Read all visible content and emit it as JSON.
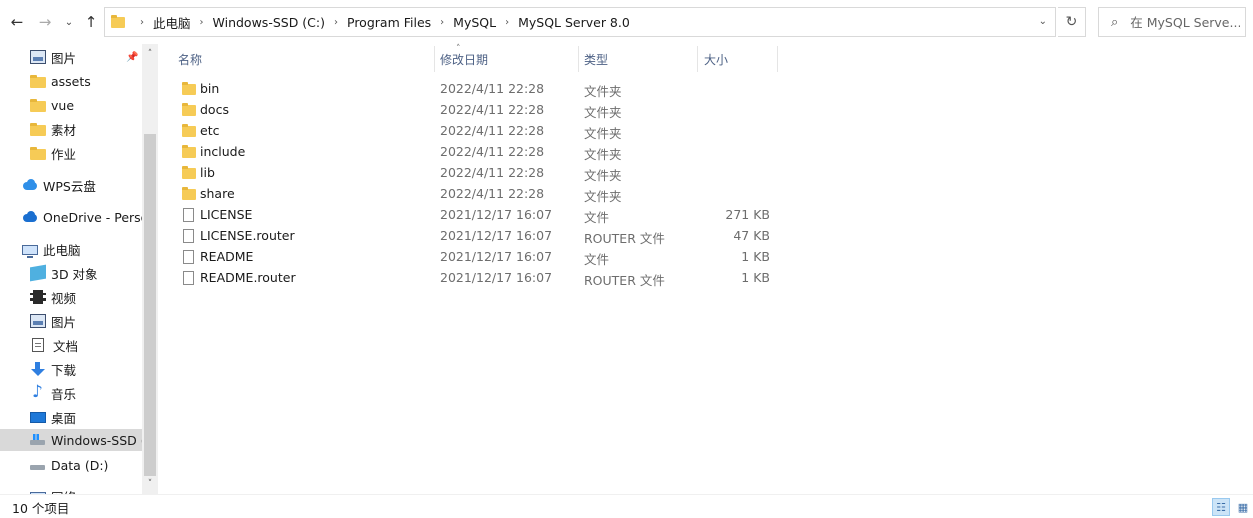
{
  "toolbar": {
    "back_glyph": "←",
    "forward_glyph": "→",
    "recent_glyph": "⌄",
    "up_glyph": "↑",
    "refresh_glyph": "↻",
    "dropdown_glyph": "⌄"
  },
  "address": {
    "separator": "›",
    "crumbs": [
      "此电脑",
      "Windows-SSD (C:)",
      "Program Files",
      "MySQL",
      "MySQL Server 8.0"
    ]
  },
  "search": {
    "icon": "⌕",
    "placeholder": "在 MySQL Serve..."
  },
  "navpane": {
    "pin_glyph": "📌",
    "items": [
      {
        "label": "图片",
        "icon": "pictures-icon"
      },
      {
        "label": "assets",
        "icon": "folder-icon"
      },
      {
        "label": "vue",
        "icon": "folder-icon"
      },
      {
        "label": "素材",
        "icon": "folder-icon"
      },
      {
        "label": "作业",
        "icon": "folder-icon"
      },
      {
        "label": "WPS云盘",
        "icon": "wps-cloud-icon"
      },
      {
        "label": "OneDrive - Perso",
        "icon": "onedrive-icon"
      },
      {
        "label": "此电脑",
        "icon": "this-pc-icon"
      },
      {
        "label": "3D 对象",
        "icon": "3d-objects-icon"
      },
      {
        "label": "视频",
        "icon": "videos-icon"
      },
      {
        "label": "图片",
        "icon": "pictures-icon"
      },
      {
        "label": "文档",
        "icon": "documents-icon"
      },
      {
        "label": "下载",
        "icon": "downloads-icon"
      },
      {
        "label": "音乐",
        "icon": "music-icon"
      },
      {
        "label": "桌面",
        "icon": "desktop-icon"
      },
      {
        "label": "Windows-SSD (",
        "icon": "windows-drive-icon",
        "selected": true
      },
      {
        "label": "Data (D:)",
        "icon": "drive-icon"
      },
      {
        "label": "网络",
        "icon": "network-icon"
      }
    ],
    "scroll_up": "˄",
    "scroll_down": "˅"
  },
  "columns": {
    "sort_glyph": "˄",
    "name": "名称",
    "date": "修改日期",
    "type": "类型",
    "size": "大小"
  },
  "files": [
    {
      "name": "bin",
      "date": "2022/4/11 22:28",
      "type": "文件夹",
      "size": "",
      "kind": "folder"
    },
    {
      "name": "docs",
      "date": "2022/4/11 22:28",
      "type": "文件夹",
      "size": "",
      "kind": "folder"
    },
    {
      "name": "etc",
      "date": "2022/4/11 22:28",
      "type": "文件夹",
      "size": "",
      "kind": "folder"
    },
    {
      "name": "include",
      "date": "2022/4/11 22:28",
      "type": "文件夹",
      "size": "",
      "kind": "folder"
    },
    {
      "name": "lib",
      "date": "2022/4/11 22:28",
      "type": "文件夹",
      "size": "",
      "kind": "folder"
    },
    {
      "name": "share",
      "date": "2022/4/11 22:28",
      "type": "文件夹",
      "size": "",
      "kind": "folder"
    },
    {
      "name": "LICENSE",
      "date": "2021/12/17 16:07",
      "type": "文件",
      "size": "271 KB",
      "kind": "file"
    },
    {
      "name": "LICENSE.router",
      "date": "2021/12/17 16:07",
      "type": "ROUTER 文件",
      "size": "47 KB",
      "kind": "file"
    },
    {
      "name": "README",
      "date": "2021/12/17 16:07",
      "type": "文件",
      "size": "1 KB",
      "kind": "file"
    },
    {
      "name": "README.router",
      "date": "2021/12/17 16:07",
      "type": "ROUTER 文件",
      "size": "1 KB",
      "kind": "file"
    }
  ],
  "status": {
    "count": "10 个项目",
    "details_glyph": "☷",
    "tiles_glyph": "▦"
  }
}
